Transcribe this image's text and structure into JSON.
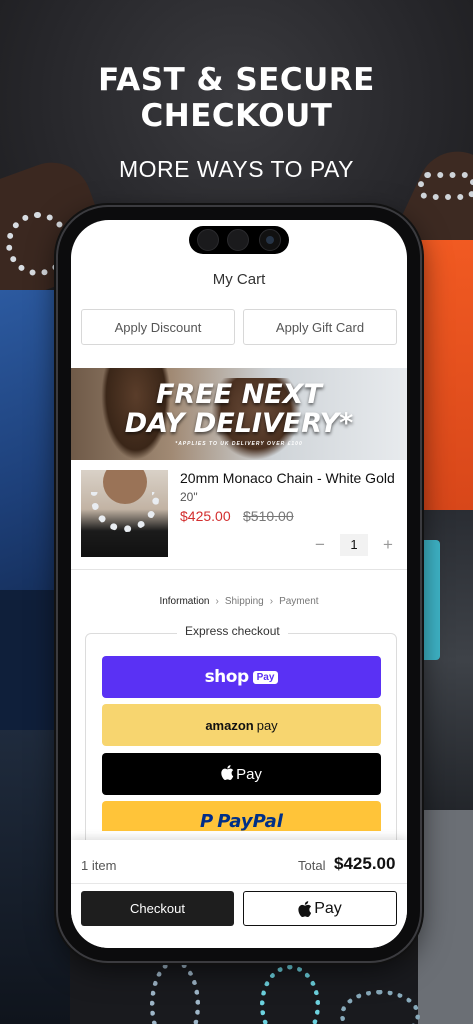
{
  "hero": {
    "title_line1": "FAST & SECURE",
    "title_line2": "CHECKOUT",
    "subtitle": "MORE WAYS TO PAY"
  },
  "cart": {
    "title": "My Cart",
    "apply_discount": "Apply Discount",
    "apply_gift_card": "Apply Gift Card"
  },
  "banner": {
    "line1": "FREE NEXT",
    "line2": "DAY DELIVERY*",
    "note": "*APPLIES TO UK DELIVERY OVER £100"
  },
  "product": {
    "name": "20mm Monaco Chain - White Gold",
    "variant": "20\"",
    "price": "$425.00",
    "compare_price": "$510.00",
    "quantity": "1",
    "minus": "−",
    "plus": "+"
  },
  "breadcrumbs": {
    "items": [
      "Information",
      "Shipping",
      "Payment"
    ],
    "separator": "›"
  },
  "express": {
    "label": "Express checkout",
    "shop_word": "shop",
    "shop_badge": "Pay",
    "amazon_word": "amazon",
    "amazon_pay": "pay",
    "apple_pay": "Pay",
    "paypal_word": "PayPal",
    "paypal_p": "P"
  },
  "summary": {
    "item_count": "1 item",
    "total_label": "Total",
    "total_value": "$425.00",
    "checkout_label": "Checkout",
    "apple_pay_label": "Pay"
  },
  "colors": {
    "shop_pay": "#5a31f4",
    "amazon_pay": "#f7d56f",
    "apple_pay": "#000000",
    "paypal": "#ffc439",
    "sale_price": "#d32f2f"
  },
  "icons": {
    "apple": "apple-icon",
    "chevron": "chevron-right-icon"
  }
}
